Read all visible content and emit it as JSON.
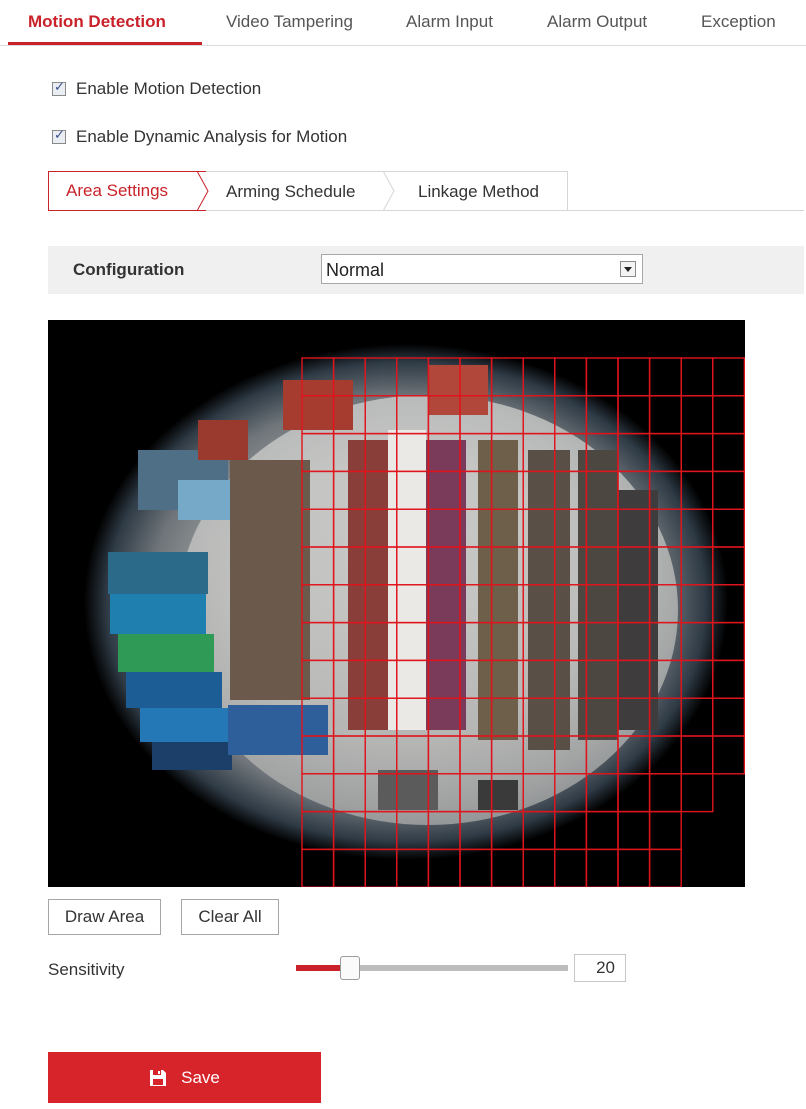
{
  "top_tabs": [
    {
      "label": "Motion Detection",
      "active": true
    },
    {
      "label": "Video Tampering",
      "active": false
    },
    {
      "label": "Alarm Input",
      "active": false
    },
    {
      "label": "Alarm Output",
      "active": false
    },
    {
      "label": "Exception",
      "active": false
    }
  ],
  "options": {
    "enable_motion": {
      "label": "Enable Motion Detection",
      "checked": true
    },
    "enable_dynamic": {
      "label": "Enable Dynamic Analysis for Motion",
      "checked": true
    }
  },
  "sub_tabs": {
    "area": "Area Settings",
    "arming": "Arming Schedule",
    "linkage": "Linkage Method"
  },
  "configuration": {
    "label": "Configuration",
    "value": "Normal"
  },
  "buttons": {
    "draw_area": "Draw Area",
    "clear_all": "Clear All",
    "save": "Save"
  },
  "sensitivity": {
    "label": "Sensitivity",
    "value": "20",
    "level_fraction": 0.2
  },
  "colors": {
    "accent": "#c9222a",
    "grid": "#e0141c"
  },
  "icons": {
    "save": "floppy-disk-icon",
    "dropdown": "chevron-down-icon",
    "check": "checkmark-icon"
  }
}
